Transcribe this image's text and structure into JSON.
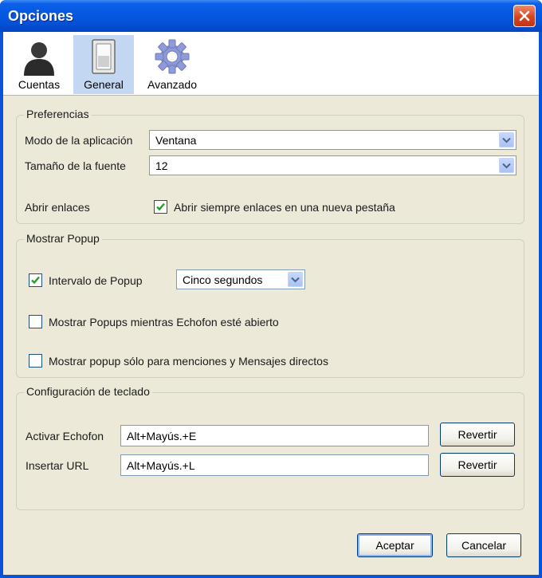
{
  "window": {
    "title": "Opciones"
  },
  "toolbar": {
    "items": [
      {
        "label": "Cuentas",
        "icon": "user-icon"
      },
      {
        "label": "General",
        "icon": "switch-icon",
        "active": true
      },
      {
        "label": "Avanzado",
        "icon": "gear-icon"
      }
    ]
  },
  "preferences": {
    "legend": "Preferencias",
    "app_mode_label": "Modo de la aplicación",
    "app_mode_value": "Ventana",
    "font_size_label": "Tamaño de la fuente",
    "font_size_value": "12",
    "open_links_label": "Abrir enlaces",
    "open_links_checkbox_label": "Abrir siempre enlaces en una nueva pestaña",
    "open_links_checked": true
  },
  "popup": {
    "legend": "Mostrar Popup",
    "interval_label": "Intervalo de Popup",
    "interval_checked": true,
    "interval_value": "Cinco segundos",
    "show_while_open_label": "Mostrar Popups mientras Echofon esté abierto",
    "show_while_open_checked": false,
    "mentions_only_label": "Mostrar popup sólo para menciones y Mensajes directos",
    "mentions_only_checked": false
  },
  "keyboard": {
    "legend": "Configuración de teclado",
    "activate_label": "Activar Echofon",
    "activate_value": "Alt+Mayús.+E",
    "insert_url_label": "Insertar URL",
    "insert_url_value": "Alt+Mayús.+L",
    "revert_label": "Revertir"
  },
  "footer": {
    "accept_label": "Aceptar",
    "cancel_label": "Cancelar"
  },
  "colors": {
    "titlebar": "#0555dd",
    "client": "#ece9d8",
    "active_tab": "#c4d7f2"
  }
}
